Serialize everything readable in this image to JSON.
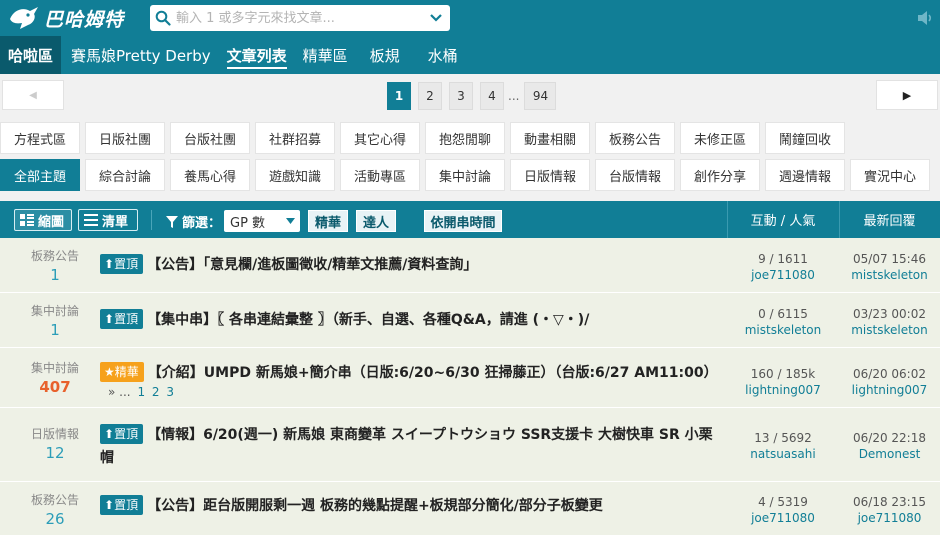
{
  "app": {
    "logo_text": "巴哈姆特"
  },
  "search": {
    "placeholder": "輸入 1 或多字元來找文章..."
  },
  "board_nav": {
    "home": "哈啦區",
    "items": [
      "賽馬娘Pretty Derby",
      "文章列表",
      "精華區",
      "板規",
      "水桶"
    ],
    "active_index": 1
  },
  "pagination": {
    "prev": "◀",
    "next": "▶",
    "pages": [
      "1",
      "2",
      "3",
      "4"
    ],
    "ellipsis": "...",
    "last": "94",
    "current": "1"
  },
  "categories": {
    "row1": [
      "方程式區",
      "日版社團",
      "台版社團",
      "社群招募",
      "其它心得",
      "抱怨閒聊",
      "動畫相關",
      "板務公告",
      "未修正區",
      "鬧鐘回收"
    ],
    "row2": [
      "全部主題",
      "綜合討論",
      "養馬心得",
      "遊戲知識",
      "活動專區",
      "集中討論",
      "日版情報",
      "台版情報",
      "創作分享",
      "週邊情報",
      "實況中心"
    ],
    "active": "全部主題"
  },
  "list_header": {
    "view_grid": "縮圖",
    "view_list": "清單",
    "filter_label": "篩選：",
    "sort_value": "GP 數",
    "tag_featured": "精華",
    "tag_expert": "達人",
    "sort_by_time": "依開串時間",
    "col_stats": "互動 / 人氣",
    "col_last": "最新回覆"
  },
  "rows": [
    {
      "category": "板務公告",
      "gp": "1",
      "badge": "置頂",
      "title": "【公告】「意見欄/進板圖徵收/精華文推薦/資料查詢」",
      "stats": "9 / 1611",
      "author": "joe711080",
      "last_time": "05/07 15:46",
      "last_user": "mistskeleton"
    },
    {
      "category": "集中討論",
      "gp": "1",
      "badge": "置頂",
      "title": "【集中串】〖 各串連結彙整 〗（新手、自選、各種Q&A，請進 (・▽・)/",
      "stats": "0 / 6115",
      "author": "mistskeleton",
      "last_time": "03/23 00:02",
      "last_user": "mistskeleton"
    },
    {
      "category": "集中討論",
      "gp": "407",
      "badge": "精華",
      "title": "【介紹】UMPD 新馬娘+簡介串（日版:6/20~6/30 狂掃藤正）（台版:6/27 AM11:00）",
      "sub_prefix": "» ...",
      "sub_pages": [
        "1",
        "2",
        "3"
      ],
      "stats": "160 / 185k",
      "author": "lightning007",
      "last_time": "06/20 06:02",
      "last_user": "lightning007"
    },
    {
      "category": "日版情報",
      "gp": "12",
      "badge": "置頂",
      "title": "【情報】6/20(週一) 新馬娘 東商變革 スイープトウショウ SSR支援卡 大樹快車 SR 小栗帽",
      "stats": "13 / 5692",
      "author": "natsuasahi",
      "last_time": "06/20 22:18",
      "last_user": "Demonest"
    },
    {
      "category": "板務公告",
      "gp": "26",
      "badge": "置頂",
      "title": "【公告】距台版開服剩一週 板務的幾點提醒+板規部分簡化/部分子板變更",
      "stats": "4 / 5319",
      "author": "joe711080",
      "last_time": "06/18 23:15",
      "last_user": "joe711080"
    }
  ]
}
